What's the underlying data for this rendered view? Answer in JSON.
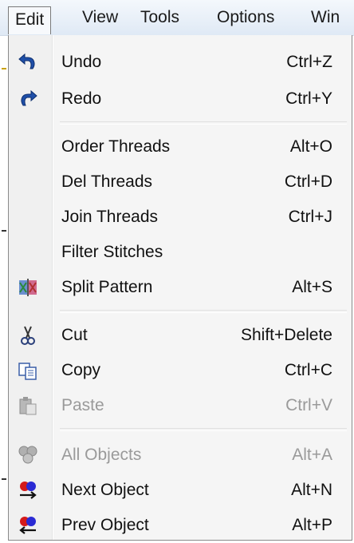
{
  "menubar": {
    "items": [
      "Edit",
      "View",
      "Tools",
      "Options",
      "Win"
    ]
  },
  "menu": {
    "undo": {
      "label": "Undo",
      "shortcut": "Ctrl+Z",
      "icon": "undo-icon"
    },
    "redo": {
      "label": "Redo",
      "shortcut": "Ctrl+Y",
      "icon": "redo-icon"
    },
    "order": {
      "label": "Order Threads",
      "shortcut": "Alt+O"
    },
    "del": {
      "label": "Del Threads",
      "shortcut": "Ctrl+D"
    },
    "join": {
      "label": "Join Threads",
      "shortcut": "Ctrl+J"
    },
    "filter": {
      "label": "Filter Stitches"
    },
    "split": {
      "label": "Split Pattern",
      "shortcut": "Alt+S",
      "icon": "split-pattern-icon"
    },
    "cut": {
      "label": "Cut",
      "shortcut": "Shift+Delete",
      "icon": "scissors-icon"
    },
    "copy": {
      "label": "Copy",
      "shortcut": "Ctrl+C",
      "icon": "copy-icon"
    },
    "paste": {
      "label": "Paste",
      "shortcut": "Ctrl+V",
      "icon": "paste-icon",
      "disabled": true
    },
    "all": {
      "label": "All Objects",
      "shortcut": "Alt+A",
      "icon": "all-objects-icon",
      "disabled": true
    },
    "next": {
      "label": "Next Object",
      "shortcut": "Alt+N",
      "icon": "next-object-icon"
    },
    "prev": {
      "label": "Prev Object",
      "shortcut": "Alt+P",
      "icon": "prev-object-icon"
    }
  }
}
